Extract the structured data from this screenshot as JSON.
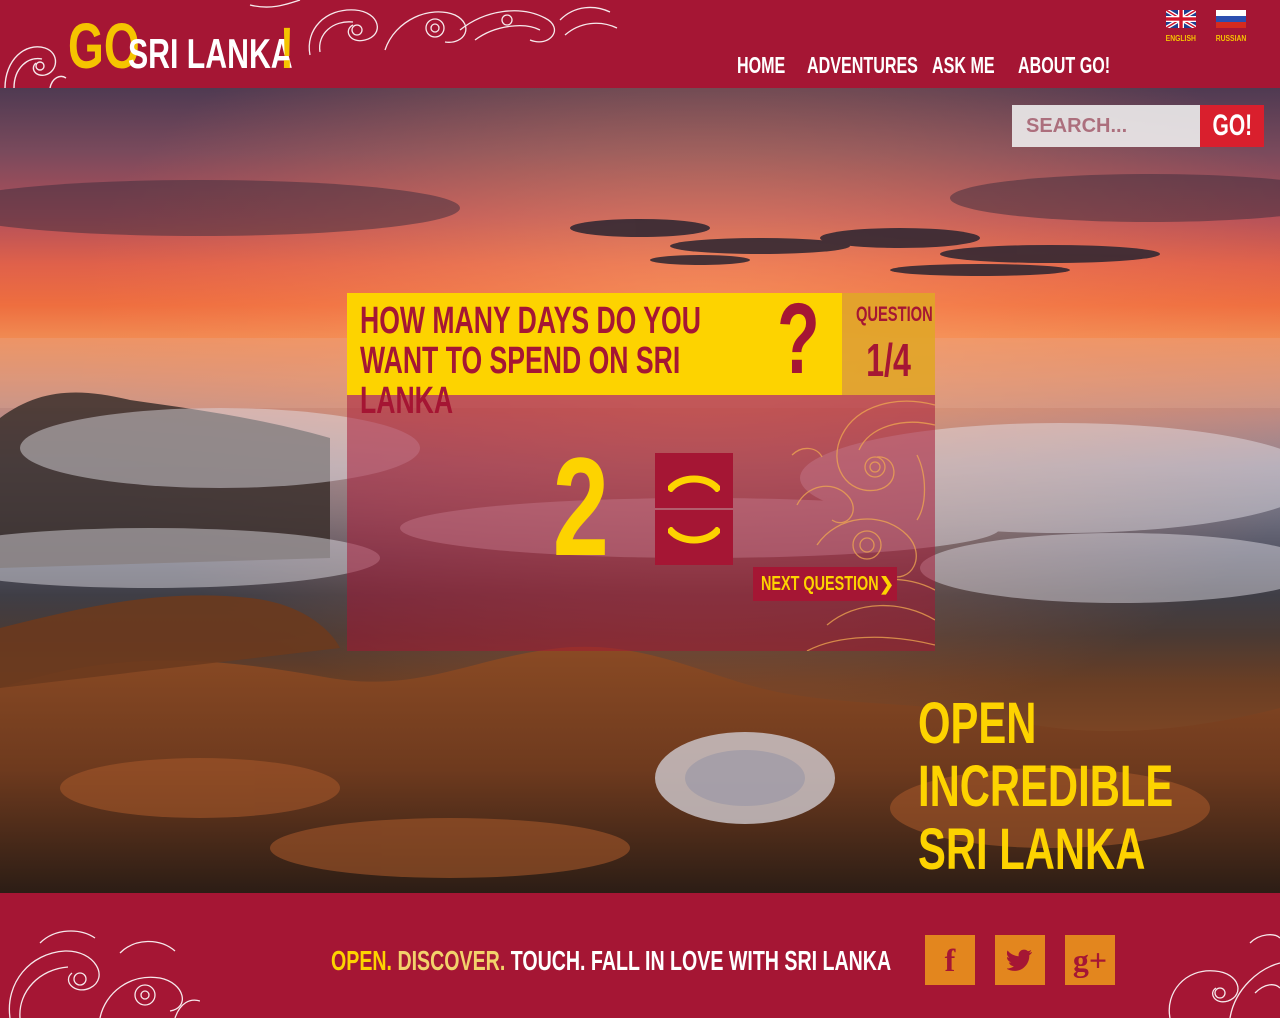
{
  "header": {
    "logo": {
      "go": "GO",
      "name": "SRI LANKA",
      "exclaim": "!"
    },
    "languages": [
      {
        "label": "ENGLISH",
        "flag": "uk-flag-icon"
      },
      {
        "label": "RUSSIAN",
        "flag": "russia-flag-icon"
      }
    ],
    "nav": [
      "HOME",
      "ADVENTURES",
      "ASK ME",
      "ABOUT GO!"
    ]
  },
  "search": {
    "placeholder": "SEARCH...",
    "button": "GO!"
  },
  "quiz": {
    "question": "HOW MANY DAYS DO YOU WANT TO SPEND ON SRI LANKA",
    "question_mark": "?",
    "counter_label": "QUESTION",
    "counter": "1/4",
    "value": "2",
    "up_icon": "chevron-up-icon",
    "down_icon": "chevron-down-icon",
    "next_label": "NEXT QUESTION",
    "next_arrow": "❯"
  },
  "tagline": "OPEN INCREDIBLE SRI LANKA",
  "footer": {
    "slogan_1": "OPEN.",
    "slogan_2": "DISCOVER.",
    "slogan_3": "TOUCH. FALL IN LOVE WITH SRI LANKA",
    "social": [
      {
        "name": "facebook-icon",
        "glyph": "f"
      },
      {
        "name": "twitter-icon",
        "glyph": ""
      },
      {
        "name": "google-plus-icon",
        "glyph": "g+"
      }
    ]
  },
  "colors": {
    "brand_red": "#a51634",
    "accent_yellow": "#fdd300",
    "search_button": "#d91f2d",
    "social_orange": "#e3861e"
  }
}
